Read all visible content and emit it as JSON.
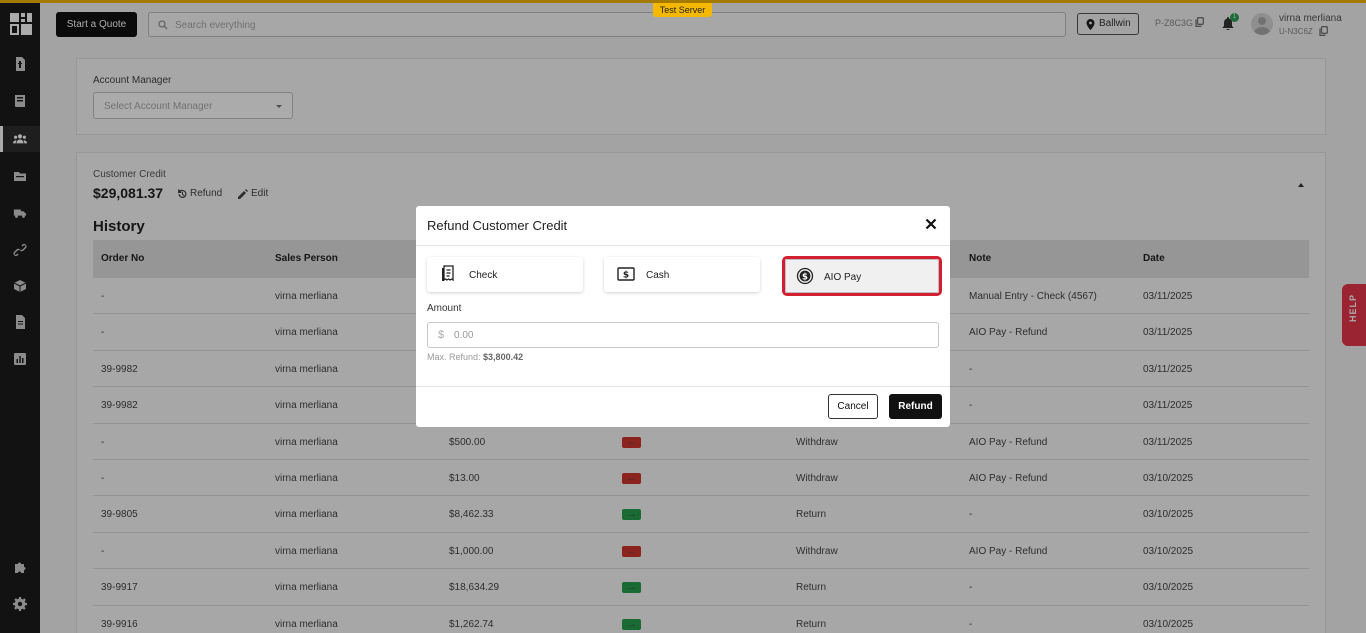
{
  "banner": {
    "test_server": "Test Server"
  },
  "header": {
    "start_quote": "Start a Quote",
    "search_placeholder": "Search everything",
    "location": "Ballwin",
    "project_code": "P-Z8C3G",
    "notification_count": "1",
    "user_name": "virna merliana",
    "user_id": "U-N3C6Z"
  },
  "sidebar": {
    "icons": [
      "invoice-icon",
      "book-icon",
      "customers-icon",
      "folder-icon",
      "truck-icon",
      "link-icon",
      "box-icon",
      "document-icon",
      "report-icon",
      "puzzle-icon",
      "gear-icon"
    ],
    "active": "customers-icon"
  },
  "account": {
    "label": "Account Manager",
    "placeholder": "Select Account Manager"
  },
  "credit": {
    "label": "Customer Credit",
    "amount": "$29,081.37",
    "refund_label": "Refund",
    "edit_label": "Edit"
  },
  "history": {
    "title": "History",
    "columns": [
      "Order No",
      "Sales Person",
      "Note",
      "Date"
    ],
    "rows": [
      {
        "order": "-",
        "sales": "virna merliana",
        "amount": "",
        "direction": "",
        "type": "",
        "note": "Manual Entry - Check (4567)",
        "date": "03/11/2025"
      },
      {
        "order": "-",
        "sales": "virna merliana",
        "amount": "",
        "direction": "",
        "type": "",
        "note": "AIO Pay - Refund",
        "date": "03/11/2025"
      },
      {
        "order": "39-9982",
        "sales": "virna merliana",
        "amount": "",
        "direction": "",
        "type": "",
        "note": "-",
        "date": "03/11/2025"
      },
      {
        "order": "39-9982",
        "sales": "virna merliana",
        "amount": "",
        "direction": "",
        "type": "",
        "note": "-",
        "date": "03/11/2025"
      },
      {
        "order": "-",
        "sales": "virna merliana",
        "amount": "$500.00",
        "direction": "out",
        "type": "Withdraw",
        "note": "AIO Pay - Refund",
        "date": "03/11/2025"
      },
      {
        "order": "-",
        "sales": "virna merliana",
        "amount": "$13.00",
        "direction": "out",
        "type": "Withdraw",
        "note": "AIO Pay - Refund",
        "date": "03/10/2025"
      },
      {
        "order": "39-9805",
        "sales": "virna merliana",
        "amount": "$8,462.33",
        "direction": "in",
        "type": "Return",
        "note": "-",
        "date": "03/10/2025"
      },
      {
        "order": "-",
        "sales": "virna merliana",
        "amount": "$1,000.00",
        "direction": "out",
        "type": "Withdraw",
        "note": "AIO Pay - Refund",
        "date": "03/10/2025"
      },
      {
        "order": "39-9917",
        "sales": "virna merliana",
        "amount": "$18,634.29",
        "direction": "in",
        "type": "Return",
        "note": "-",
        "date": "03/10/2025"
      },
      {
        "order": "39-9916",
        "sales": "virna merliana",
        "amount": "$1,262.74",
        "direction": "in",
        "type": "Return",
        "note": "-",
        "date": "03/10/2025"
      }
    ]
  },
  "help_tab": "HELP",
  "modal": {
    "title": "Refund Customer Credit",
    "methods": [
      {
        "label": "Check",
        "icon": "receipt-icon"
      },
      {
        "label": "Cash",
        "icon": "cash-icon"
      },
      {
        "label": "AIO Pay",
        "icon": "dollar-coin-icon"
      }
    ],
    "selected_method": "AIO Pay",
    "amount_label": "Amount",
    "currency_symbol": "$",
    "amount_placeholder": "0.00",
    "amount_value": "",
    "max_refund_label": "Max. Refund:",
    "max_refund_value": "$3,800.42",
    "cancel_label": "Cancel",
    "refund_label": "Refund"
  },
  "colors": {
    "accent": "#f5b800",
    "withdraw": "#d0372e",
    "return": "#26a04c",
    "highlight": "#d22030",
    "help": "#e6364a"
  }
}
